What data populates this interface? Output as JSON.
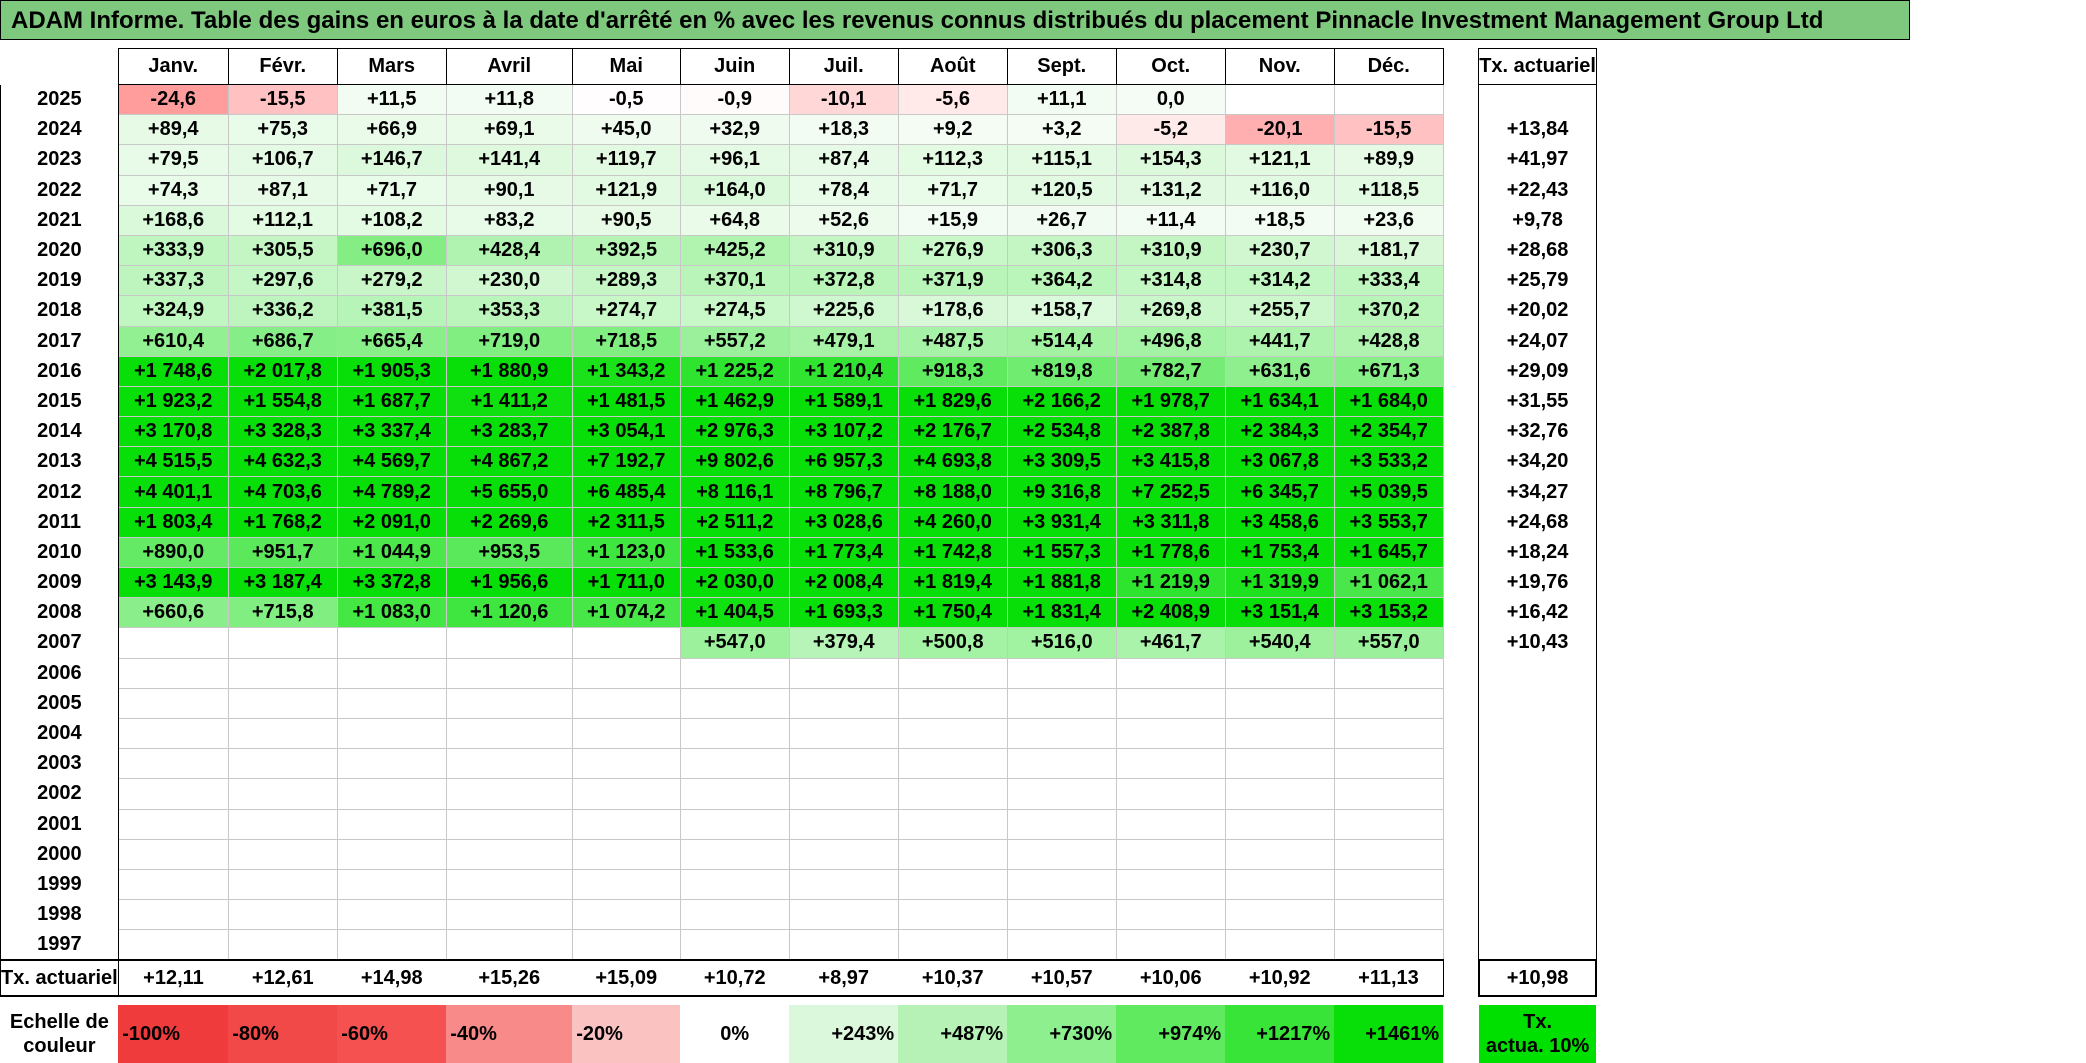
{
  "title": "ADAM Informe. Table des gains en euros à la date d'arrêté en % avec les revenus connus distribués du placement Pinnacle Investment Management Group Ltd",
  "header": {
    "months": [
      "Janv.",
      "Févr.",
      "Mars",
      "Avril",
      "Mai",
      "Juin",
      "Juil.",
      "Août",
      "Sept.",
      "Oct.",
      "Nov.",
      "Déc."
    ],
    "tx_label": "Tx. actuariel"
  },
  "rows": [
    {
      "year": "2025",
      "values": [
        "-24,6",
        "-15,5",
        "+11,5",
        "+11,8",
        "-0,5",
        "-0,9",
        "-10,1",
        "-5,6",
        "+11,1",
        "0,0",
        "",
        ""
      ],
      "tx": ""
    },
    {
      "year": "2024",
      "values": [
        "+89,4",
        "+75,3",
        "+66,9",
        "+69,1",
        "+45,0",
        "+32,9",
        "+18,3",
        "+9,2",
        "+3,2",
        "-5,2",
        "-20,1",
        "-15,5"
      ],
      "tx": "+13,84"
    },
    {
      "year": "2023",
      "values": [
        "+79,5",
        "+106,7",
        "+146,7",
        "+141,4",
        "+119,7",
        "+96,1",
        "+87,4",
        "+112,3",
        "+115,1",
        "+154,3",
        "+121,1",
        "+89,9"
      ],
      "tx": "+41,97"
    },
    {
      "year": "2022",
      "values": [
        "+74,3",
        "+87,1",
        "+71,7",
        "+90,1",
        "+121,9",
        "+164,0",
        "+78,4",
        "+71,7",
        "+120,5",
        "+131,2",
        "+116,0",
        "+118,5"
      ],
      "tx": "+22,43"
    },
    {
      "year": "2021",
      "values": [
        "+168,6",
        "+112,1",
        "+108,2",
        "+83,2",
        "+90,5",
        "+64,8",
        "+52,6",
        "+15,9",
        "+26,7",
        "+11,4",
        "+18,5",
        "+23,6"
      ],
      "tx": "+9,78"
    },
    {
      "year": "2020",
      "values": [
        "+333,9",
        "+305,5",
        "+696,0",
        "+428,4",
        "+392,5",
        "+425,2",
        "+310,9",
        "+276,9",
        "+306,3",
        "+310,9",
        "+230,7",
        "+181,7"
      ],
      "tx": "+28,68"
    },
    {
      "year": "2019",
      "values": [
        "+337,3",
        "+297,6",
        "+279,2",
        "+230,0",
        "+289,3",
        "+370,1",
        "+372,8",
        "+371,9",
        "+364,2",
        "+314,8",
        "+314,2",
        "+333,4"
      ],
      "tx": "+25,79"
    },
    {
      "year": "2018",
      "values": [
        "+324,9",
        "+336,2",
        "+381,5",
        "+353,3",
        "+274,7",
        "+274,5",
        "+225,6",
        "+178,6",
        "+158,7",
        "+269,8",
        "+255,7",
        "+370,2"
      ],
      "tx": "+20,02"
    },
    {
      "year": "2017",
      "values": [
        "+610,4",
        "+686,7",
        "+665,4",
        "+719,0",
        "+718,5",
        "+557,2",
        "+479,1",
        "+487,5",
        "+514,4",
        "+496,8",
        "+441,7",
        "+428,8"
      ],
      "tx": "+24,07"
    },
    {
      "year": "2016",
      "values": [
        "+1 748,6",
        "+2 017,8",
        "+1 905,3",
        "+1 880,9",
        "+1 343,2",
        "+1 225,2",
        "+1 210,4",
        "+918,3",
        "+819,8",
        "+782,7",
        "+631,6",
        "+671,3"
      ],
      "tx": "+29,09"
    },
    {
      "year": "2015",
      "values": [
        "+1 923,2",
        "+1 554,8",
        "+1 687,7",
        "+1 411,2",
        "+1 481,5",
        "+1 462,9",
        "+1 589,1",
        "+1 829,6",
        "+2 166,2",
        "+1 978,7",
        "+1 634,1",
        "+1 684,0"
      ],
      "tx": "+31,55"
    },
    {
      "year": "2014",
      "values": [
        "+3 170,8",
        "+3 328,3",
        "+3 337,4",
        "+3 283,7",
        "+3 054,1",
        "+2 976,3",
        "+3 107,2",
        "+2 176,7",
        "+2 534,8",
        "+2 387,8",
        "+2 384,3",
        "+2 354,7"
      ],
      "tx": "+32,76"
    },
    {
      "year": "2013",
      "values": [
        "+4 515,5",
        "+4 632,3",
        "+4 569,7",
        "+4 867,2",
        "+7 192,7",
        "+9 802,6",
        "+6 957,3",
        "+4 693,8",
        "+3 309,5",
        "+3 415,8",
        "+3 067,8",
        "+3 533,2"
      ],
      "tx": "+34,20"
    },
    {
      "year": "2012",
      "values": [
        "+4 401,1",
        "+4 703,6",
        "+4 789,2",
        "+5 655,0",
        "+6 485,4",
        "+8 116,1",
        "+8 796,7",
        "+8 188,0",
        "+9 316,8",
        "+7 252,5",
        "+6 345,7",
        "+5 039,5"
      ],
      "tx": "+34,27"
    },
    {
      "year": "2011",
      "values": [
        "+1 803,4",
        "+1 768,2",
        "+2 091,0",
        "+2 269,6",
        "+2 311,5",
        "+2 511,2",
        "+3 028,6",
        "+4 260,0",
        "+3 931,4",
        "+3 311,8",
        "+3 458,6",
        "+3 553,7"
      ],
      "tx": "+24,68"
    },
    {
      "year": "2010",
      "values": [
        "+890,0",
        "+951,7",
        "+1 044,9",
        "+953,5",
        "+1 123,0",
        "+1 533,6",
        "+1 773,4",
        "+1 742,8",
        "+1 557,3",
        "+1 778,6",
        "+1 753,4",
        "+1 645,7"
      ],
      "tx": "+18,24"
    },
    {
      "year": "2009",
      "values": [
        "+3 143,9",
        "+3 187,4",
        "+3 372,8",
        "+1 956,6",
        "+1 711,0",
        "+2 030,0",
        "+2 008,4",
        "+1 819,4",
        "+1 881,8",
        "+1 219,9",
        "+1 319,9",
        "+1 062,1"
      ],
      "tx": "+19,76"
    },
    {
      "year": "2008",
      "values": [
        "+660,6",
        "+715,8",
        "+1 083,0",
        "+1 120,6",
        "+1 074,2",
        "+1 404,5",
        "+1 693,3",
        "+1 750,4",
        "+1 831,4",
        "+2 408,9",
        "+3 151,4",
        "+3 153,2"
      ],
      "tx": "+16,42"
    },
    {
      "year": "2007",
      "values": [
        "",
        "",
        "",
        "",
        "",
        "+547,0",
        "+379,4",
        "+500,8",
        "+516,0",
        "+461,7",
        "+540,4",
        "+557,0"
      ],
      "tx": "+10,43"
    },
    {
      "year": "2006",
      "values": [
        "",
        "",
        "",
        "",
        "",
        "",
        "",
        "",
        "",
        "",
        "",
        ""
      ],
      "tx": ""
    },
    {
      "year": "2005",
      "values": [
        "",
        "",
        "",
        "",
        "",
        "",
        "",
        "",
        "",
        "",
        "",
        ""
      ],
      "tx": ""
    },
    {
      "year": "2004",
      "values": [
        "",
        "",
        "",
        "",
        "",
        "",
        "",
        "",
        "",
        "",
        "",
        ""
      ],
      "tx": ""
    },
    {
      "year": "2003",
      "values": [
        "",
        "",
        "",
        "",
        "",
        "",
        "",
        "",
        "",
        "",
        "",
        ""
      ],
      "tx": ""
    },
    {
      "year": "2002",
      "values": [
        "",
        "",
        "",
        "",
        "",
        "",
        "",
        "",
        "",
        "",
        "",
        ""
      ],
      "tx": ""
    },
    {
      "year": "2001",
      "values": [
        "",
        "",
        "",
        "",
        "",
        "",
        "",
        "",
        "",
        "",
        "",
        ""
      ],
      "tx": ""
    },
    {
      "year": "2000",
      "values": [
        "",
        "",
        "",
        "",
        "",
        "",
        "",
        "",
        "",
        "",
        "",
        ""
      ],
      "tx": ""
    },
    {
      "year": "1999",
      "values": [
        "",
        "",
        "",
        "",
        "",
        "",
        "",
        "",
        "",
        "",
        "",
        ""
      ],
      "tx": ""
    },
    {
      "year": "1998",
      "values": [
        "",
        "",
        "",
        "",
        "",
        "",
        "",
        "",
        "",
        "",
        "",
        ""
      ],
      "tx": ""
    },
    {
      "year": "1997",
      "values": [
        "",
        "",
        "",
        "",
        "",
        "",
        "",
        "",
        "",
        "",
        "",
        ""
      ],
      "tx": ""
    }
  ],
  "annual": {
    "label": "Tx. actuariel",
    "values": [
      "+12,11",
      "+12,61",
      "+14,98",
      "+15,26",
      "+15,09",
      "+10,72",
      "+8,97",
      "+10,37",
      "+10,57",
      "+10,06",
      "+10,92",
      "+11,13"
    ],
    "tx": "+10,98"
  },
  "scale": {
    "label_line1": "Echelle de",
    "label_line2": "couleur",
    "steps": [
      {
        "label": "-100%",
        "color": "#ef3b3b"
      },
      {
        "label": "-80%",
        "color": "#f14848"
      },
      {
        "label": "-60%",
        "color": "#f55151"
      },
      {
        "label": "-40%",
        "color": "#f88a8a"
      },
      {
        "label": "-20%",
        "color": "#fbc2c2"
      },
      {
        "label": "0%",
        "color": "#ffffff"
      },
      {
        "label": "+243%",
        "color": "#dcf8dc"
      },
      {
        "label": "+487%",
        "color": "#b6f2b6"
      },
      {
        "label": "+730%",
        "color": "#8def8d"
      },
      {
        "label": "+974%",
        "color": "#5fea5f"
      },
      {
        "label": "+1217%",
        "color": "#37e437"
      },
      {
        "label": "+1461%",
        "color": "#08df08"
      }
    ],
    "tx_line1": "Tx.",
    "tx_line2": "actua. 10%",
    "tx_color": "#00e000"
  }
}
